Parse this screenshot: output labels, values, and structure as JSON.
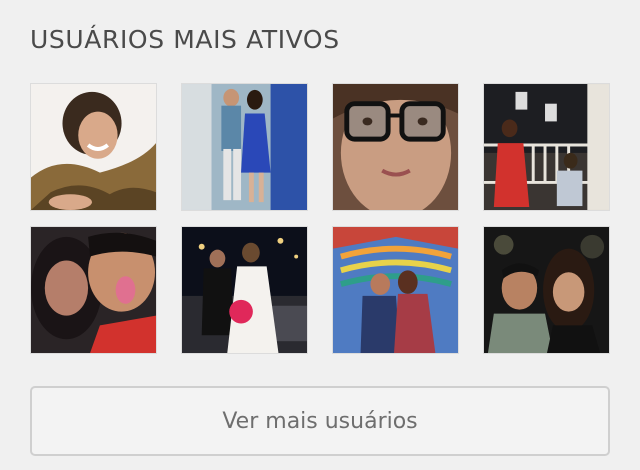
{
  "section": {
    "title": "USUÁRIOS MAIS ATIVOS"
  },
  "users": [
    {
      "icon": "user-photo-icon"
    },
    {
      "icon": "user-photo-icon"
    },
    {
      "icon": "user-photo-icon"
    },
    {
      "icon": "user-photo-icon"
    },
    {
      "icon": "user-photo-icon"
    },
    {
      "icon": "user-photo-icon"
    },
    {
      "icon": "user-photo-icon"
    },
    {
      "icon": "user-photo-icon"
    }
  ],
  "more_button": {
    "label": "Ver mais usuários"
  },
  "colors": {
    "background": "#f0f0f0",
    "title": "#4a4a4a",
    "button_border": "#cfcfcf",
    "button_text": "#6e6e6e"
  }
}
